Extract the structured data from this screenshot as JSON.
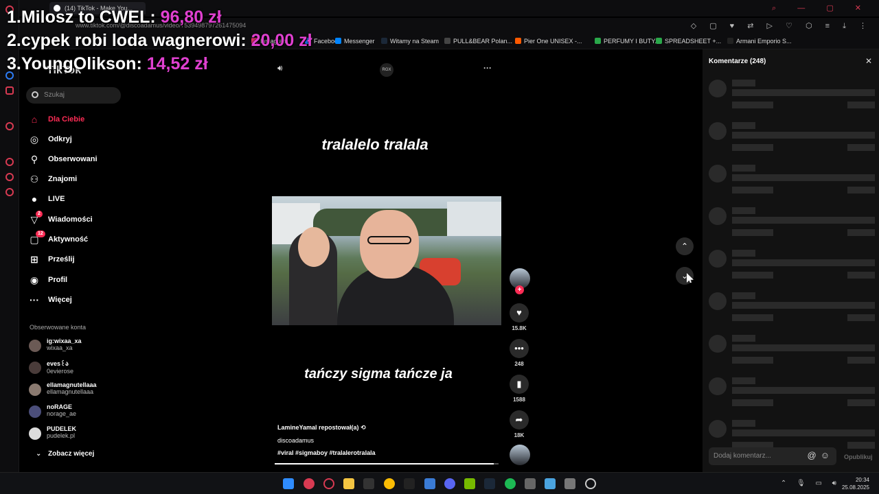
{
  "overlay": {
    "ranking": [
      {
        "rank": "1.",
        "name": "Milosz to CWEL:",
        "amount": "96,80 zł"
      },
      {
        "rank": "2.",
        "name": "cypek robi loda wagnerowi:",
        "amount": "20,00 zł"
      },
      {
        "rank": "3.",
        "name": "YoungOlikson:",
        "amount": "14,52 zł"
      }
    ]
  },
  "browser": {
    "tab_title": "(14) TikTok - Make You...",
    "url": "www.tiktok.com/@discoadamus/video/7539498797261475094",
    "bookmarks": [
      {
        "label": "Instagram",
        "color": "#e1306c"
      },
      {
        "label": "Facebook",
        "color": "#1877f2"
      },
      {
        "label": "Messenger",
        "color": "#0084ff"
      },
      {
        "label": "Witamy na Steam",
        "color": "#1b2838"
      },
      {
        "label": "PULL&BEAR Polan...",
        "color": "#444"
      },
      {
        "label": "Pier One UNISEX -...",
        "color": "#ff5a00"
      },
      {
        "label": "PERFUMY I BUTY...",
        "color": "#2aa84a"
      },
      {
        "label": "SPREADSHEET +...",
        "color": "#2aa84a"
      },
      {
        "label": "Armani Emporio S...",
        "color": "#222"
      }
    ]
  },
  "tiktok": {
    "logo": "TikTok",
    "search_placeholder": "Szukaj",
    "nav": [
      {
        "label": "Dla Ciebie",
        "icon": "home-icon",
        "glyph": "⌂",
        "active": true
      },
      {
        "label": "Odkryj",
        "icon": "compass-icon",
        "glyph": "◎"
      },
      {
        "label": "Obserwowani",
        "icon": "user-follow-icon",
        "glyph": "⚲"
      },
      {
        "label": "Znajomi",
        "icon": "friends-icon",
        "glyph": "⚇"
      },
      {
        "label": "LIVE",
        "icon": "live-icon",
        "glyph": "●"
      },
      {
        "label": "Wiadomości",
        "icon": "messages-icon",
        "glyph": "▽",
        "badge": "2"
      },
      {
        "label": "Aktywność",
        "icon": "activity-icon",
        "glyph": "▢",
        "badge": "12"
      },
      {
        "label": "Prześlij",
        "icon": "upload-icon",
        "glyph": "⊞"
      },
      {
        "label": "Profil",
        "icon": "profile-icon",
        "glyph": "◉"
      },
      {
        "label": "Więcej",
        "icon": "more-icon",
        "glyph": "···"
      }
    ],
    "followed_title": "Obserwowane konta",
    "followed": [
      {
        "name": "ig:wixaa_xa",
        "handle": "wixaa_xa"
      },
      {
        "name": "eves꒰ა",
        "handle": "0evierose"
      },
      {
        "name": "ellamagnutellaaa",
        "handle": "ellamagnutellaaa"
      },
      {
        "name": "noRAGE",
        "handle": "norage_ae"
      },
      {
        "name": "PUDELEK",
        "handle": "pudelek.pl"
      }
    ],
    "see_more": "Zobacz więcej"
  },
  "video": {
    "top_badge": "RGX",
    "caption_top": "tralalelo tralala",
    "caption_bottom": "tańczy sigma tańcze ja",
    "repost_user": "LamineYamal",
    "repost_text": "repostował(a)",
    "author": "discoadamus",
    "hashtags": "#viral #sigmaboy #tralalerotralala",
    "progress": 0.98,
    "likes": "15.8K",
    "comments": "248",
    "saves": "1588",
    "shares": "18K"
  },
  "comments": {
    "title": "Komentarze (248)",
    "input_placeholder": "Dodaj komentarz...",
    "post_label": "Opublikuj"
  },
  "taskbar": {
    "time": "20:34",
    "date": "25.08.2025"
  }
}
